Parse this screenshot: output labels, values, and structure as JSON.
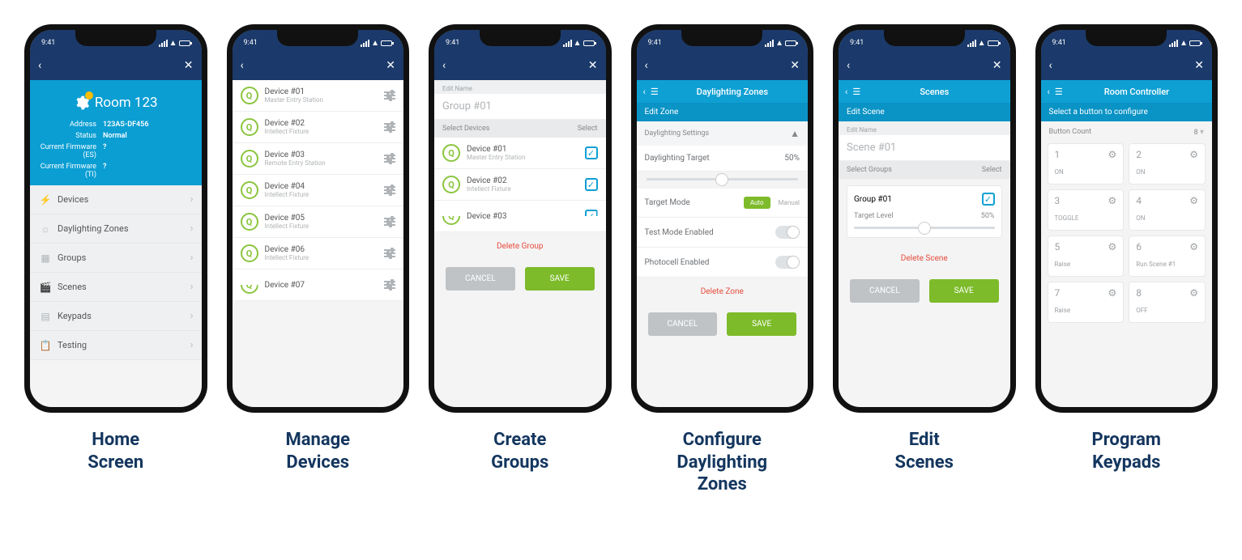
{
  "status_time": "9:41",
  "captions": [
    "Home\nScreen",
    "Manage\nDevices",
    "Create\nGroups",
    "Configure\nDaylighting\nZones",
    "Edit\nScenes",
    "Program\nKeypads"
  ],
  "home": {
    "title": "Room 123",
    "address_key": "Address",
    "address": "123AS-DF456",
    "status_key": "Status",
    "status": "Normal",
    "fw_es_key": "Current Firmware (ES)",
    "fw_es": "?",
    "fw_ti_key": "Current Firmware (TI)",
    "fw_ti": "?",
    "menu": [
      "Devices",
      "Daylighting Zones",
      "Groups",
      "Scenes",
      "Keypads",
      "Testing"
    ]
  },
  "devices": [
    {
      "name": "Device #01",
      "sub": "Master Entry Station"
    },
    {
      "name": "Device #02",
      "sub": "Intellect Fixture"
    },
    {
      "name": "Device #03",
      "sub": "Remote Entry Station"
    },
    {
      "name": "Device #04",
      "sub": "Intellect Fixture"
    },
    {
      "name": "Device #05",
      "sub": "Intellect Fixture"
    },
    {
      "name": "Device #06",
      "sub": "Intellect Fixture"
    },
    {
      "name": "Device #07",
      "sub": ""
    }
  ],
  "groups": {
    "edit_name_label": "Edit Name",
    "name": "Group #01",
    "select_devices": "Select Devices",
    "select": "Select",
    "list": [
      {
        "name": "Device #01",
        "sub": "Master Entry Station"
      },
      {
        "name": "Device #02",
        "sub": "Intellect Fixture"
      },
      {
        "name": "Device #03",
        "sub": ""
      }
    ],
    "delete": "Delete Group",
    "cancel": "CANCEL",
    "save": "SAVE"
  },
  "dl": {
    "title": "Daylighting Zones",
    "edit_zone": "Edit Zone",
    "settings": "Daylighting Settings",
    "target_label": "Daylighting Target",
    "target_value": "50%",
    "slider_pct": 50,
    "mode_label": "Target Mode",
    "mode_auto": "Auto",
    "mode_manual": "Manual",
    "test_label": "Test Mode Enabled",
    "photocell_label": "Photocell Enabled",
    "delete": "Delete Zone",
    "cancel": "CANCEL",
    "save": "SAVE"
  },
  "scenes": {
    "title": "Scenes",
    "edit_scene": "Edit Scene",
    "edit_name_label": "Edit Name",
    "name": "Scene #01",
    "select_groups": "Select Groups",
    "select": "Select",
    "group_name": "Group #01",
    "target_label": "Target Level",
    "target_value": "50%",
    "slider_pct": 50,
    "delete": "Delete Scene",
    "cancel": "CANCEL",
    "save": "SAVE"
  },
  "keypad": {
    "title": "Room Controller",
    "select_btn": "Select a button to configure",
    "count_label": "Button Count",
    "count_value": "8",
    "buttons": [
      {
        "n": "1",
        "l": "ON"
      },
      {
        "n": "2",
        "l": "ON"
      },
      {
        "n": "3",
        "l": "TOGGLE"
      },
      {
        "n": "4",
        "l": "ON"
      },
      {
        "n": "5",
        "l": "Raise"
      },
      {
        "n": "6",
        "l": "Run Scene #1"
      },
      {
        "n": "7",
        "l": "Raise"
      },
      {
        "n": "8",
        "l": "OFF"
      }
    ]
  }
}
